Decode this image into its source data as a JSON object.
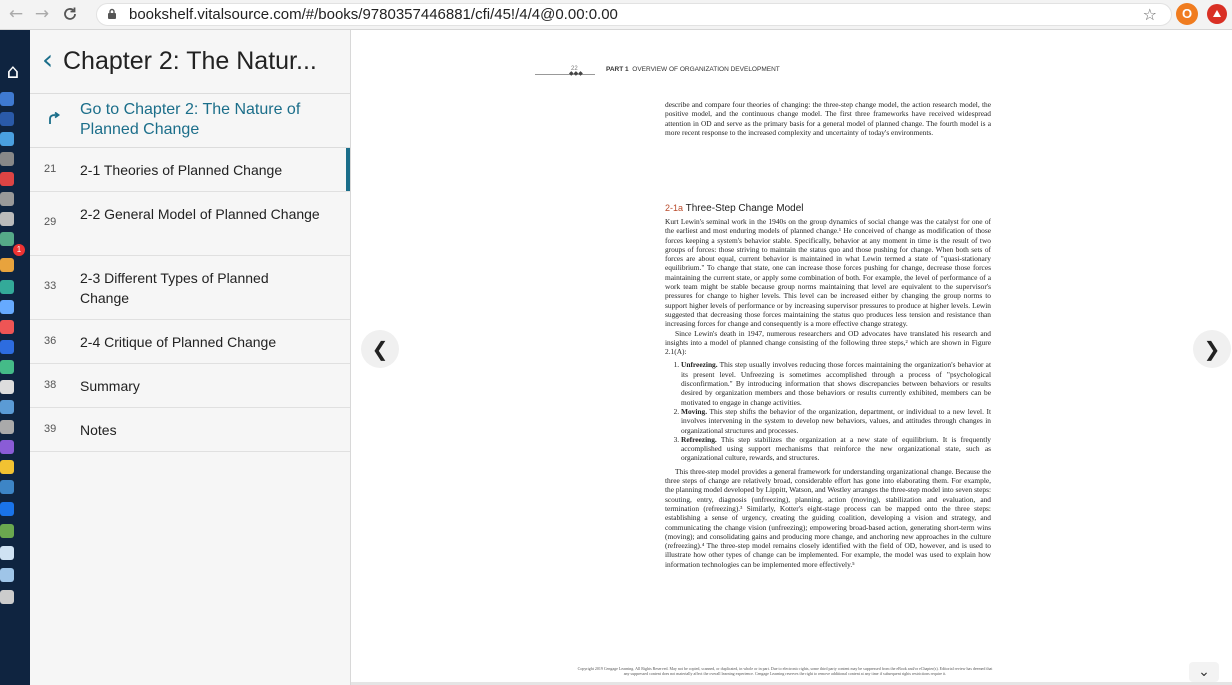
{
  "browser": {
    "back": "←",
    "forward": "→",
    "reload": "C",
    "url": "bookshelf.vitalsource.com/#/books/9780357446881/cfi/45!/4/4@0.00:0.00",
    "profile_initial": "O",
    "ext_badge": "1"
  },
  "sidebar": {
    "title": "Chapter 2: The Natur...",
    "goto_label": "Go to Chapter 2: The Nature of Planned Change",
    "items": [
      {
        "page": "21",
        "label": "2-1 Theories of Planned Change"
      },
      {
        "page": "29",
        "label": "2-2 General Model of Planned Change"
      },
      {
        "page": "33",
        "label": "2-3 Different Types of Planned Change"
      },
      {
        "page": "36",
        "label": "2-4 Critique of Planned Change"
      },
      {
        "page": "38",
        "label": "Summary"
      },
      {
        "page": "39",
        "label": "Notes"
      }
    ]
  },
  "page": {
    "number": "22",
    "part_label": "PART 1",
    "part_title": "OVERVIEW OF ORGANIZATION DEVELOPMENT",
    "intro": "describe and compare four theories of changing: the three-step change model, the action research model, the positive model, and the continuous change model. The first three frameworks have received widespread attention in OD and serve as the primary basis for a general model of planned change. The fourth model is a more recent response to the increased complexity and uncertainty of today's environments.",
    "section_num": "2-1a",
    "section_title": "Three-Step Change Model",
    "para1": "Kurt Lewin's seminal work in the 1940s on the group dynamics of social change was the catalyst for one of the earliest and most enduring models of planned change.¹ He conceived of change as modification of those forces keeping a system's behavior stable. Specifically, behavior at any moment in time is the result of two groups of forces: those striving to maintain the status quo and those pushing for change. When both sets of forces are about equal, current behavior is maintained in what Lewin termed a state of \"quasi-stationary equilibrium.\" To change that state, one can increase those forces pushing for change, decrease those forces maintaining the current state, or apply some combination of both. For example, the level of performance of a work team might be stable because group norms maintaining that level are equivalent to the supervisor's pressures for change to higher levels. This level can be increased either by changing the group norms to support higher levels of performance or by increasing supervisor pressures to produce at higher levels. Lewin suggested that decreasing those forces maintaining the status quo produces less tension and resistance than increasing forces for change and consequently is a more effective change strategy.",
    "para2": "Since Lewin's death in 1947, numerous researchers and OD advocates have translated his research and insights into a model of planned change consisting of the following three steps,² which are shown in Figure 2.1(A):",
    "steps": [
      {
        "name": "Unfreezing.",
        "text": " This step usually involves reducing those forces maintaining the organization's behavior at its present level. Unfreezing is sometimes accomplished through a process of \"psychological disconfirmation.\" By introducing information that shows discrepancies between behaviors or results desired by organization members and those behaviors or results currently exhibited, members can be motivated to engage in change activities."
      },
      {
        "name": "Moving.",
        "text": " This step shifts the behavior of the organization, department, or individual to a new level. It involves intervening in the system to develop new behaviors, values, and attitudes through changes in organizational structures and processes."
      },
      {
        "name": "Refreezing.",
        "text": " This step stabilizes the organization at a new state of equilibrium. It is frequently accomplished using support mechanisms that reinforce the new organizational state, such as organizational culture, rewards, and structures."
      }
    ],
    "para3": "This three-step model provides a general framework for understanding organizational change. Because the three steps of change are relatively broad, considerable effort has gone into elaborating them. For example, the planning model developed by Lippitt, Watson, and Westley arranges the three-step model into seven steps: scouting, entry, diagnosis (unfreezing), planning, action (moving), stabilization and evaluation, and termination (refreezing).³ Similarly, Kotter's eight-stage process can be mapped onto the three steps: establishing a sense of urgency, creating the guiding coalition, developing a vision and strategy, and communicating the change vision (unfreezing); empowering broad-based action, generating short-term wins (moving); and consolidating gains and producing more change, and anchoring new approaches in the culture (refreezing).⁴ The three-step model remains closely identified with the field of OD, however, and is used to illustrate how other types of change can be implemented. For example, the model was used to explain how information technologies can be implemented more effectively.⁵",
    "footer": "Copyright 2019 Cengage Learning. All Rights Reserved. May not be copied, scanned, or duplicated, in whole or in part. Due to electronic rights, some third party content may be suppressed from the eBook and/or eChapter(s). Editorial review has deemed that any suppressed content does not materially affect the overall learning experience. Cengage Learning reserves the right to remove additional content at any time if subsequent rights restrictions require it."
  },
  "controls": {
    "prev": "❮",
    "next": "❯",
    "down": "⌄"
  },
  "colors": {
    "accent": "#1b6e8a",
    "dock": "#0f2440",
    "section_num": "#b94a2a"
  }
}
